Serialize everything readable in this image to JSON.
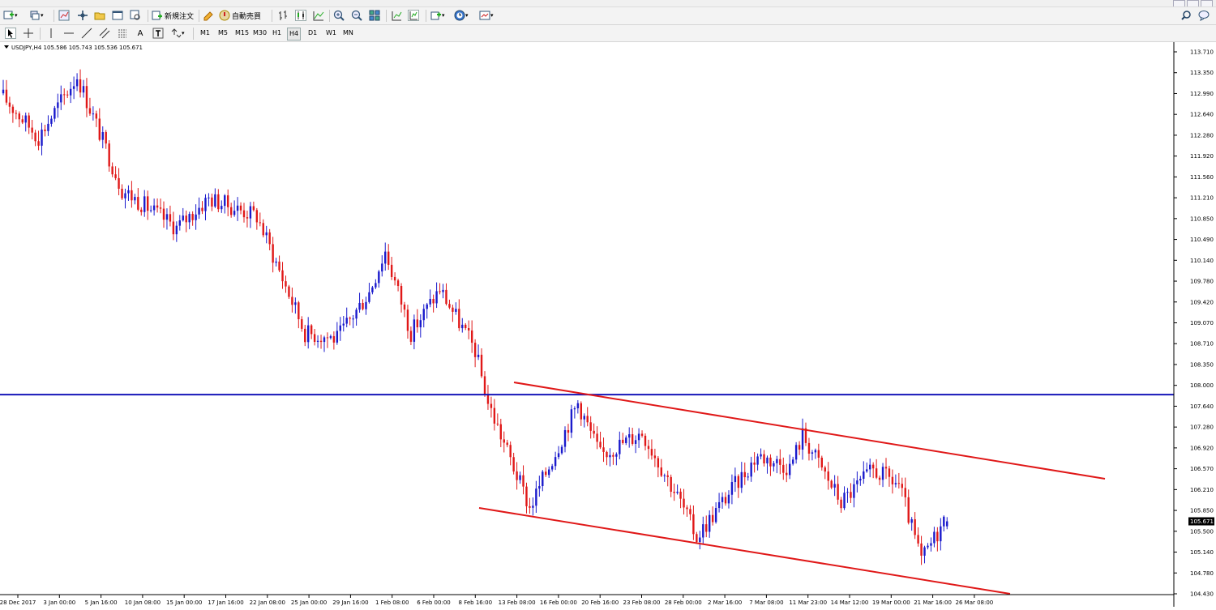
{
  "toolbar": {
    "new_order_label": "新規注文",
    "auto_trade_label": "自動売買",
    "timeframes": [
      "M1",
      "M5",
      "M15",
      "M30",
      "H1",
      "H4",
      "D1",
      "W1",
      "MN"
    ],
    "active_timeframe": "H4"
  },
  "chart": {
    "symbol_info": "USDJPY,H4  105.586 105.743 105.536 105.671",
    "current_price_label": "105.671",
    "price_labels": [
      "113.710",
      "113.350",
      "112.990",
      "112.640",
      "112.280",
      "111.920",
      "111.560",
      "111.210",
      "110.850",
      "110.490",
      "110.140",
      "109.780",
      "109.420",
      "109.070",
      "108.710",
      "108.350",
      "108.000",
      "107.640",
      "107.280",
      "106.920",
      "106.570",
      "106.210",
      "105.850",
      "105.500",
      "105.140",
      "104.780",
      "104.430"
    ],
    "time_labels": [
      "28 Dec 2017",
      "3 Jan 00:00",
      "5 Jan 16:00",
      "10 Jan 08:00",
      "15 Jan 00:00",
      "17 Jan 16:00",
      "22 Jan 08:00",
      "25 Jan 00:00",
      "29 Jan 16:00",
      "1 Feb 08:00",
      "6 Feb 00:00",
      "8 Feb 16:00",
      "13 Feb 08:00",
      "16 Feb 00:00",
      "20 Feb 16:00",
      "23 Feb 08:00",
      "28 Feb 00:00",
      "2 Mar 16:00",
      "7 Mar 08:00",
      "11 Mar 23:00",
      "14 Mar 12:00",
      "19 Mar 00:00",
      "21 Mar 16:00",
      "26 Mar 08:00"
    ],
    "colors": {
      "bull": "#1a1acc",
      "bear": "#e01818",
      "hline": "#1515b8",
      "trendline": "#e01818"
    }
  },
  "chart_data": {
    "type": "candlestick",
    "symbol": "USDJPY",
    "timeframe": "H4",
    "last_bar": {
      "open": 105.586,
      "high": 105.743,
      "low": 105.536,
      "close": 105.671
    },
    "ylim": [
      104.43,
      113.71
    ],
    "path_keypoints": [
      {
        "bar": 0,
        "price": 113.0
      },
      {
        "bar": 12,
        "price": 112.25
      },
      {
        "bar": 24,
        "price": 113.3
      },
      {
        "bar": 38,
        "price": 111.35
      },
      {
        "bar": 55,
        "price": 110.7
      },
      {
        "bar": 65,
        "price": 111.2
      },
      {
        "bar": 80,
        "price": 110.9
      },
      {
        "bar": 95,
        "price": 108.9
      },
      {
        "bar": 105,
        "price": 108.8
      },
      {
        "bar": 115,
        "price": 109.6
      },
      {
        "bar": 120,
        "price": 110.3
      },
      {
        "bar": 128,
        "price": 108.9
      },
      {
        "bar": 137,
        "price": 109.65
      },
      {
        "bar": 148,
        "price": 108.6
      },
      {
        "bar": 152,
        "price": 107.7
      },
      {
        "bar": 165,
        "price": 105.9
      },
      {
        "bar": 180,
        "price": 107.7
      },
      {
        "bar": 187,
        "price": 106.8
      },
      {
        "bar": 200,
        "price": 107.2
      },
      {
        "bar": 212,
        "price": 106.0
      },
      {
        "bar": 217,
        "price": 105.4
      },
      {
        "bar": 225,
        "price": 106.0
      },
      {
        "bar": 236,
        "price": 106.8
      },
      {
        "bar": 246,
        "price": 106.6
      },
      {
        "bar": 250,
        "price": 107.15
      },
      {
        "bar": 262,
        "price": 106.0
      },
      {
        "bar": 272,
        "price": 106.55
      },
      {
        "bar": 280,
        "price": 106.3
      },
      {
        "bar": 287,
        "price": 105.0
      },
      {
        "bar": 294,
        "price": 105.67
      }
    ],
    "horizontal_line": {
      "price": 107.84
    },
    "channel": {
      "upper": [
        {
          "time": "13 Feb 08:00",
          "price": 108.05
        },
        {
          "time": "28 Mar",
          "price": 106.4
        }
      ],
      "lower": [
        {
          "time": "13 Feb",
          "price": 105.9
        },
        {
          "time": "28 Mar",
          "price": 104.43
        }
      ]
    }
  }
}
